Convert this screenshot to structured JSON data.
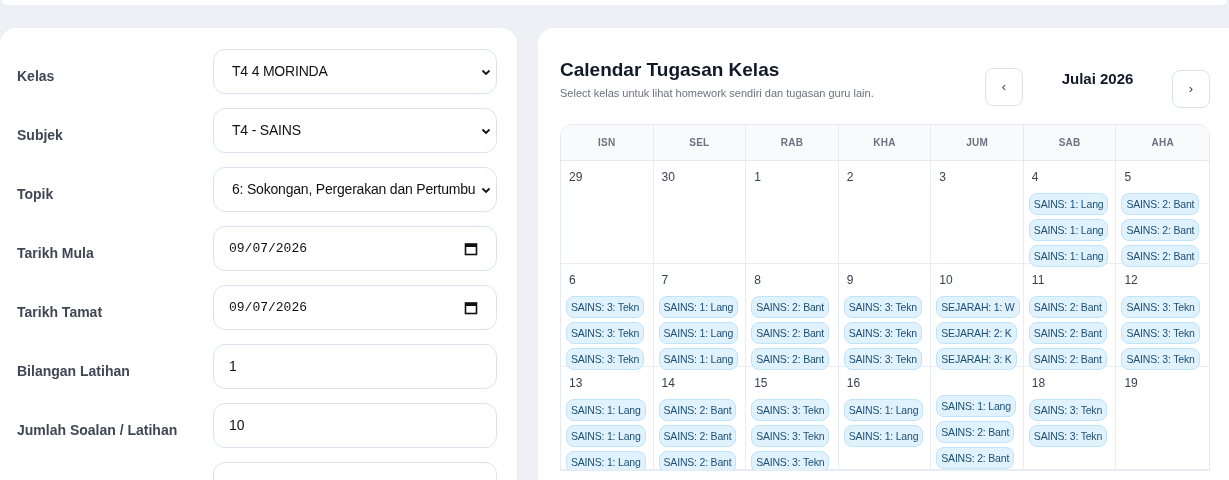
{
  "form": {
    "fields": [
      {
        "kind": "select",
        "label": "Kelas",
        "value": "T4 4 MORINDA"
      },
      {
        "kind": "select",
        "label": "Subjek",
        "value": "T4 - SAINS"
      },
      {
        "kind": "select",
        "label": "Topik",
        "value": "6: Sokongan, Pergerakan dan Pertumbu"
      },
      {
        "kind": "date",
        "label": "Tarikh Mula",
        "value": "09/07/2026"
      },
      {
        "kind": "date",
        "label": "Tarikh Tamat",
        "value": "09/07/2026"
      },
      {
        "kind": "number",
        "label": "Bilangan Latihan",
        "value": "1"
      },
      {
        "kind": "number",
        "label": "Jumlah Soalan / Latihan",
        "value": "10"
      },
      {
        "kind": "text"
      }
    ]
  },
  "calendar": {
    "title": "Calendar Tugasan Kelas",
    "subtitle": "Select kelas untuk lihat homework sendiri dan tugasan guru lain.",
    "month": "Julai 2026",
    "prev": "‹",
    "next": "›",
    "weekdays": [
      "ISN",
      "SEL",
      "RAB",
      "KHA",
      "JUM",
      "SAB",
      "AHA"
    ],
    "weeks": [
      [
        {
          "day": "29"
        },
        {
          "day": "30"
        },
        {
          "day": "1"
        },
        {
          "day": "2"
        },
        {
          "day": "3"
        },
        {
          "day": "4",
          "events": [
            "SAINS: 1: Lang",
            "SAINS: 1: Lang",
            "SAINS: 1: Lang"
          ]
        },
        {
          "day": "5",
          "events": [
            "SAINS: 2: Bant",
            "SAINS: 2: Bant",
            "SAINS: 2: Bant"
          ]
        }
      ],
      [
        {
          "day": "6",
          "events": [
            "SAINS: 3: Tekn",
            "SAINS: 3: Tekn",
            "SAINS: 3: Tekn"
          ]
        },
        {
          "day": "7",
          "events": [
            "SAINS: 1: Lang",
            "SAINS: 1: Lang",
            "SAINS: 1: Lang"
          ]
        },
        {
          "day": "8",
          "events": [
            "SAINS: 2: Bant",
            "SAINS: 2: Bant",
            "SAINS: 2: Bant"
          ]
        },
        {
          "day": "9",
          "events": [
            "SAINS: 3: Tekn",
            "SAINS: 3: Tekn",
            "SAINS: 3: Tekn"
          ]
        },
        {
          "day": "10",
          "events": [
            "SEJARAH: 1: W",
            "SEJARAH: 2: K",
            "SEJARAH: 3: K"
          ]
        },
        {
          "day": "11",
          "events": [
            "SAINS: 2: Bant",
            "SAINS: 2: Bant",
            "SAINS: 2: Bant"
          ]
        },
        {
          "day": "12",
          "events": [
            "SAINS: 3: Tekn",
            "SAINS: 3: Tekn",
            "SAINS: 3: Tekn"
          ]
        }
      ],
      [
        {
          "day": "13",
          "events": [
            "SAINS: 1: Lang",
            "SAINS: 1: Lang",
            "SAINS: 1: Lang"
          ]
        },
        {
          "day": "14",
          "events": [
            "SAINS: 2: Bant",
            "SAINS: 2: Bant",
            "SAINS: 2: Bant"
          ]
        },
        {
          "day": "15",
          "events": [
            "SAINS: 3: Tekn",
            "SAINS: 3: Tekn",
            "SAINS: 3: Tekn"
          ]
        },
        {
          "day": "16",
          "events": [
            "SAINS: 1: Lang",
            "SAINS: 1: Lang"
          ]
        },
        {
          "events": [
            "SAINS: 1: Lang",
            "SAINS: 2: Bant",
            "SAINS: 2: Bant"
          ]
        },
        {
          "day": "18",
          "events": [
            "SAINS: 3: Tekn",
            "SAINS: 3: Tekn"
          ]
        },
        {
          "day": "19"
        }
      ]
    ]
  }
}
